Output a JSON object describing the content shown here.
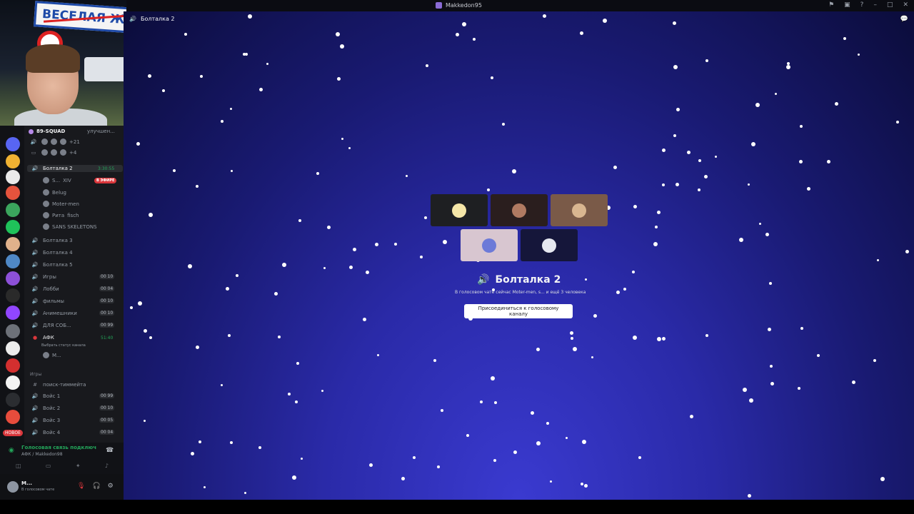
{
  "window": {
    "title": "Makkedon95"
  },
  "webcam": {
    "sign_text": "ВЕСЕЛАЯ ЖИЗ"
  },
  "server": {
    "name": "89-SQUAD",
    "boost_text": "улучшен...",
    "voice_extra_count": "+21",
    "voice_extra_count2": "+4"
  },
  "channels": {
    "active": {
      "name": "Болталка 2",
      "timer": "3:30:55"
    },
    "active_users": [
      {
        "name": "S...",
        "extra": "XIV",
        "live": "В ЭФИРЕ"
      },
      {
        "name": "Belug"
      },
      {
        "name": "Moter-men"
      },
      {
        "name": "Рита",
        "extra": "fisch"
      },
      {
        "name": "SANS SKELETONS"
      }
    ],
    "voice_list": [
      {
        "name": "Болталка 3",
        "count": ""
      },
      {
        "name": "Болталка 4",
        "count": ""
      },
      {
        "name": "Болталка 5",
        "count": ""
      },
      {
        "name": "Игры",
        "count": "00 10"
      },
      {
        "name": "Лобби",
        "count": "00 04"
      },
      {
        "name": "фильмы",
        "count": "00 10"
      },
      {
        "name": "Анимешники",
        "count": "00 10"
      },
      {
        "name": "ДЛЯ СОБ...",
        "count": "00 99"
      }
    ],
    "afk": {
      "name": "АФК",
      "timer": "51:40",
      "status": "Выбрать статус канала",
      "user": "M..."
    },
    "category": "Игры",
    "text_channel": "поиск-тиммейта",
    "voice_list2": [
      {
        "name": "Войс 1",
        "count": "00 99"
      },
      {
        "name": "Войс 2",
        "count": "00 10"
      },
      {
        "name": "Войс 3",
        "count": "00 05"
      },
      {
        "name": "Войс 4",
        "count": "00 04"
      }
    ]
  },
  "servers_strip": {
    "new_badge": "НОВОЕ"
  },
  "voice_panel": {
    "title": "Голосовая связь подключ",
    "subtitle": "АФК / Makkedon98"
  },
  "user_panel": {
    "name": "M...",
    "status": "В голосовом чате"
  },
  "main": {
    "header_channel": "Болталка 2",
    "voice_channel_title": "Болталка 2",
    "description": "В голосовом чате сейчас Moter-men, s... и ещё 3 человека",
    "join_button": "Присоединиться к голосовому каналу"
  }
}
